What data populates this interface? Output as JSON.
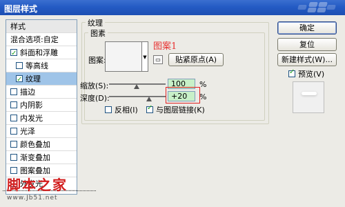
{
  "window": {
    "title": "图层样式"
  },
  "styles_panel": {
    "header": "样式",
    "items": [
      {
        "label": "混合选项:自定",
        "checked": null,
        "selected": false,
        "sub": false
      },
      {
        "label": "斜面和浮雕",
        "checked": true,
        "selected": false,
        "sub": false
      },
      {
        "label": "等高线",
        "checked": false,
        "selected": false,
        "sub": true
      },
      {
        "label": "纹理",
        "checked": true,
        "selected": true,
        "sub": true
      },
      {
        "label": "描边",
        "checked": false,
        "selected": false,
        "sub": false
      },
      {
        "label": "内阴影",
        "checked": false,
        "selected": false,
        "sub": false
      },
      {
        "label": "内发光",
        "checked": false,
        "selected": false,
        "sub": false
      },
      {
        "label": "光泽",
        "checked": false,
        "selected": false,
        "sub": false
      },
      {
        "label": "颜色叠加",
        "checked": false,
        "selected": false,
        "sub": false
      },
      {
        "label": "渐变叠加",
        "checked": false,
        "selected": false,
        "sub": false
      },
      {
        "label": "图案叠加",
        "checked": false,
        "selected": false,
        "sub": false
      },
      {
        "label": "外发光",
        "checked": false,
        "selected": false,
        "sub": false
      }
    ]
  },
  "texture": {
    "group_title": "纹理",
    "elements_title": "图素",
    "pattern_label": "图案:",
    "annotation": "图案1",
    "snap_button": "贴紧原点(A)",
    "scale_label": "缩放(S):",
    "scale_value": "100",
    "scale_unit": "%",
    "depth_label": "深度(D):",
    "depth_value": "+20",
    "depth_unit": "%",
    "invert_label": "反相(I)",
    "invert_checked": false,
    "link_label": "与图层链接(K)",
    "link_checked": true
  },
  "buttons": {
    "ok": "确定",
    "reset": "复位",
    "new_style": "新建样式(W)...",
    "preview_label": "预览(V)",
    "preview_checked": true
  },
  "watermark": {
    "text": "脚本之家",
    "url": "www.Jb51.net"
  },
  "colors": {
    "titlebar": "#245bc4",
    "selection": "#9fc4e8",
    "annotation": "#e83030"
  }
}
